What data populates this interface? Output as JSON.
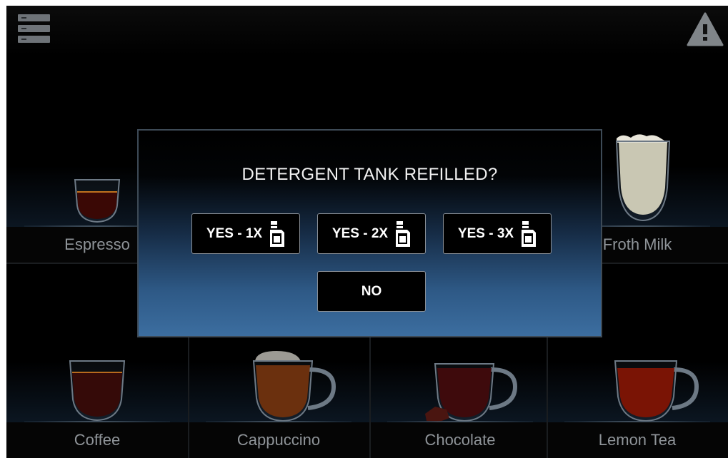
{
  "header": {
    "menu_icon": "menu-icon",
    "warning_icon": "warning-icon"
  },
  "drinks": [
    {
      "label": "Espresso"
    },
    {
      "label": "Froth Milk"
    },
    {
      "label": "Coffee"
    },
    {
      "label": "Cappuccino"
    },
    {
      "label": "Chocolate"
    },
    {
      "label": "Lemon Tea"
    }
  ],
  "dialog": {
    "title": "DETERGENT TANK REFILLED?",
    "buttons": [
      {
        "label": "YES - 1X",
        "icon": "detergent-bottle-icon"
      },
      {
        "label": "YES - 2X",
        "icon": "detergent-bottle-icon"
      },
      {
        "label": "YES - 3X",
        "icon": "detergent-bottle-icon"
      }
    ],
    "no_label": "NO"
  },
  "colors": {
    "dialog_gradient_bottom": "#3c6ea0",
    "label_text": "#8f9499",
    "button_border": "#8a9097"
  }
}
